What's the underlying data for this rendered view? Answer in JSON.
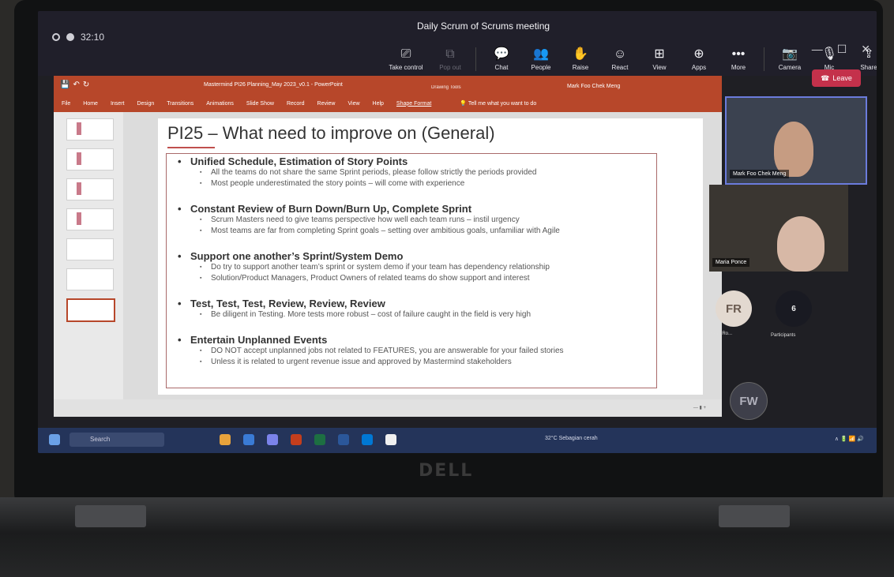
{
  "meeting": {
    "title": "Daily Scrum of Scrums meeting",
    "timer": "32:10",
    "toolbar": [
      {
        "label": "Take control",
        "icon": "take-control-icon"
      },
      {
        "label": "Pop out",
        "icon": "pop-out-icon"
      },
      {
        "label": "Chat",
        "icon": "chat-icon"
      },
      {
        "label": "People",
        "icon": "people-icon"
      },
      {
        "label": "Raise",
        "icon": "raise-hand-icon"
      },
      {
        "label": "React",
        "icon": "react-icon"
      },
      {
        "label": "View",
        "icon": "view-icon"
      },
      {
        "label": "Apps",
        "icon": "apps-icon"
      },
      {
        "label": "More",
        "icon": "more-icon"
      },
      {
        "label": "Camera",
        "icon": "camera-off-icon"
      },
      {
        "label": "Mic",
        "icon": "mic-off-icon"
      },
      {
        "label": "Share",
        "icon": "share-icon"
      }
    ],
    "leave_label": "Leave",
    "accent_color": "#c4314b"
  },
  "ppt": {
    "doc_title": "Mastermind PI26 Planning_May 2023_v0.1 - PowerPoint",
    "context_tab": "Drawing Tools",
    "user": "Mark Foo Chek Meng",
    "tabs": [
      "File",
      "Home",
      "Insert",
      "Design",
      "Transitions",
      "Animations",
      "Slide Show",
      "Record",
      "Review",
      "View",
      "Help",
      "Shape Format"
    ],
    "search_placeholder": "Tell me what you want to do",
    "accent_color": "#b7472a"
  },
  "slide": {
    "title": "PI25 – What need to improve on (General)",
    "sections": [
      {
        "heading": "Unified Schedule, Estimation of Story Points",
        "bullets": [
          "All the teams do not share the same Sprint periods, please follow strictly the periods provided",
          "Most people underestimated the story points – will come with experience"
        ]
      },
      {
        "heading": "Constant Review of Burn Down/Burn Up, Complete Sprint",
        "bullets": [
          "Scrum Masters need to give teams perspective how well each team runs – instil urgency",
          "Most teams are far from completing Sprint goals – setting over ambitious goals, unfamiliar with Agile"
        ]
      },
      {
        "heading": "Support one another’s Sprint/System Demo",
        "bullets": [
          "Do try to support another team’s sprint or system demo if your team has dependency relationship",
          "Solution/Product Managers, Product Owners of related teams do show support and interest"
        ]
      },
      {
        "heading": "Test, Test, Test, Review, Review, Review",
        "bullets": [
          "Be diligent in Testing. More tests more robust – cost of failure caught in the field is very high"
        ]
      },
      {
        "heading": "Entertain Unplanned Events",
        "bullets": [
          "DO NOT accept unplanned jobs not related to FEATURES, you are answerable for your failed stories",
          "Unless it is related to urgent revenue issue and approved by Mastermind stakeholders"
        ]
      }
    ]
  },
  "participants": {
    "video1_name": "Mark Foo Chek Meng",
    "video2_name": "Maria Ponce",
    "avatar1_initials": "FR",
    "avatar1_name": "Feryan Ro...",
    "more_count": "6",
    "more_label": "Participants",
    "avatar2_initials": "FW"
  },
  "taskbar": {
    "search_label": "Search",
    "weather": "32°C  Sebagian cerah"
  },
  "brand": "DELL"
}
